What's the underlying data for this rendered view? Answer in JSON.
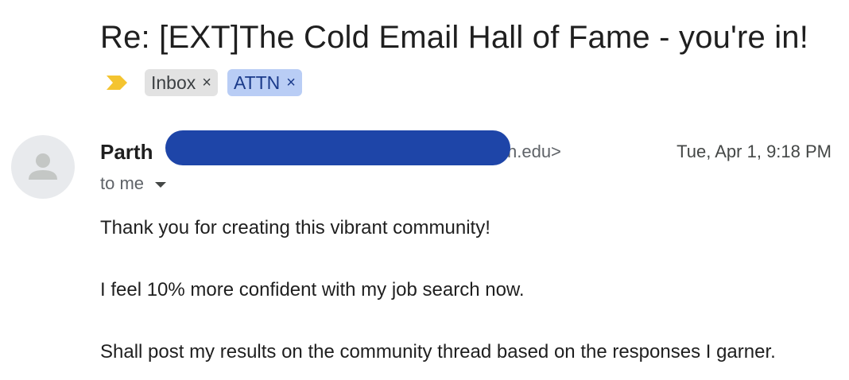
{
  "email": {
    "subject": "Re: [EXT]The Cold Email Hall of Fame - you're in!",
    "importance_icon": "importance-marker-icon",
    "labels": [
      {
        "name": "Inbox",
        "color": "#e2e2e2"
      },
      {
        "name": "ATTN",
        "color": "#b9cdf5"
      }
    ],
    "remove_glyph": "×",
    "sender": {
      "name": "Parth",
      "email_visible_part": "n.edu>",
      "avatar_icon": "default-avatar-icon"
    },
    "date": "Tue, Apr 1, 9:18 PM",
    "recipient": "to me",
    "body": [
      "Thank you for creating this vibrant community!",
      "I feel 10% more confident with my job search now.",
      "Shall post my results on the community thread based on the responses I garner."
    ]
  },
  "colors": {
    "redaction": "#1e45a8",
    "importance_marker": "#f4c430"
  }
}
